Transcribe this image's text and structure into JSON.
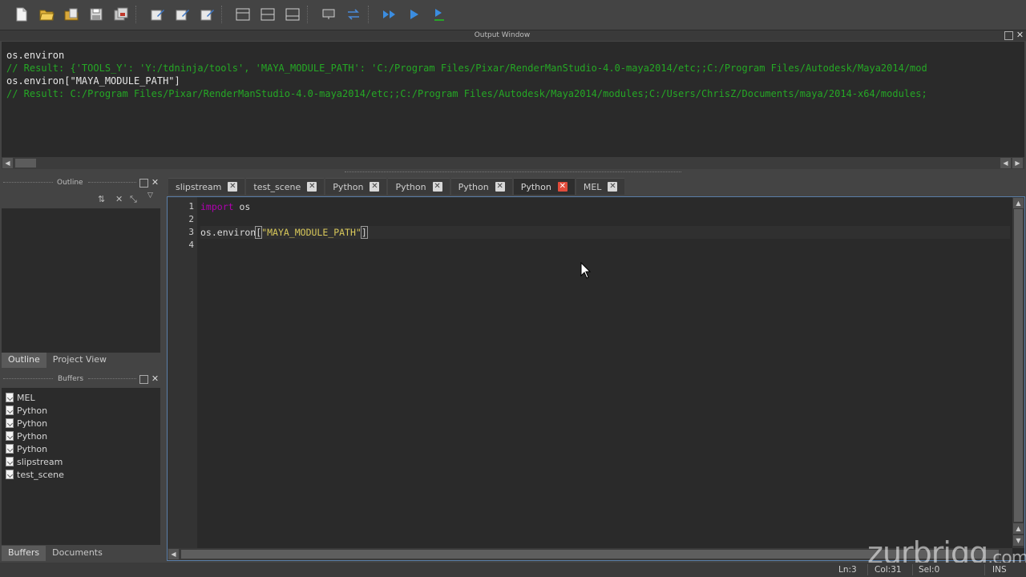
{
  "output_window": {
    "title": "Output Window",
    "lines": [
      {
        "kind": "cmd",
        "text": "os.environ"
      },
      {
        "kind": "result",
        "text": "// Result: {'TOOLS_Y': 'Y:/tdninja/tools', 'MAYA_MODULE_PATH': 'C:/Program Files/Pixar/RenderManStudio-4.0-maya2014/etc;;C:/Program Files/Autodesk/Maya2014/mod"
      },
      {
        "kind": "cmd",
        "text": "os.environ[\"MAYA_MODULE_PATH\"]"
      },
      {
        "kind": "result",
        "text": "// Result: C:/Program Files/Pixar/RenderManStudio-4.0-maya2014/etc;;C:/Program Files/Autodesk/Maya2014/modules;C:/Users/ChrisZ/Documents/maya/2014-x64/modules;"
      }
    ]
  },
  "outline_panel": {
    "title": "Outline",
    "tabs": [
      "Outline",
      "Project View"
    ]
  },
  "buffers_panel": {
    "title": "Buffers",
    "items": [
      "MEL",
      "Python",
      "Python",
      "Python",
      "Python",
      "slipstream",
      "test_scene"
    ],
    "tabs": [
      "Buffers",
      "Documents"
    ]
  },
  "editor": {
    "tabs": [
      {
        "label": "slipstream",
        "active": false
      },
      {
        "label": "test_scene",
        "active": false
      },
      {
        "label": "Python",
        "active": false
      },
      {
        "label": "Python",
        "active": false
      },
      {
        "label": "Python",
        "active": false
      },
      {
        "label": "Python",
        "active": true
      },
      {
        "label": "MEL",
        "active": false
      }
    ],
    "line_numbers": [
      "1",
      "2",
      "3",
      "4"
    ],
    "code": {
      "line1_keyword": "import",
      "line1_rest": " os",
      "line3_prefix": "os.environ",
      "line3_open": "[",
      "line3_string": "\"MAYA_MODULE_PATH\"",
      "line3_close": "]"
    }
  },
  "status_bar": {
    "line": "Ln:3",
    "col": "Col:31",
    "sel": "Sel:0",
    "mode": "INS"
  },
  "watermark": {
    "main": "zurbrigg",
    "suffix": ".com"
  },
  "colors": {
    "keyword": "#b000b0",
    "string": "#d8c85a",
    "result": "#25a825",
    "active_tab_close": "#e14b3b"
  }
}
